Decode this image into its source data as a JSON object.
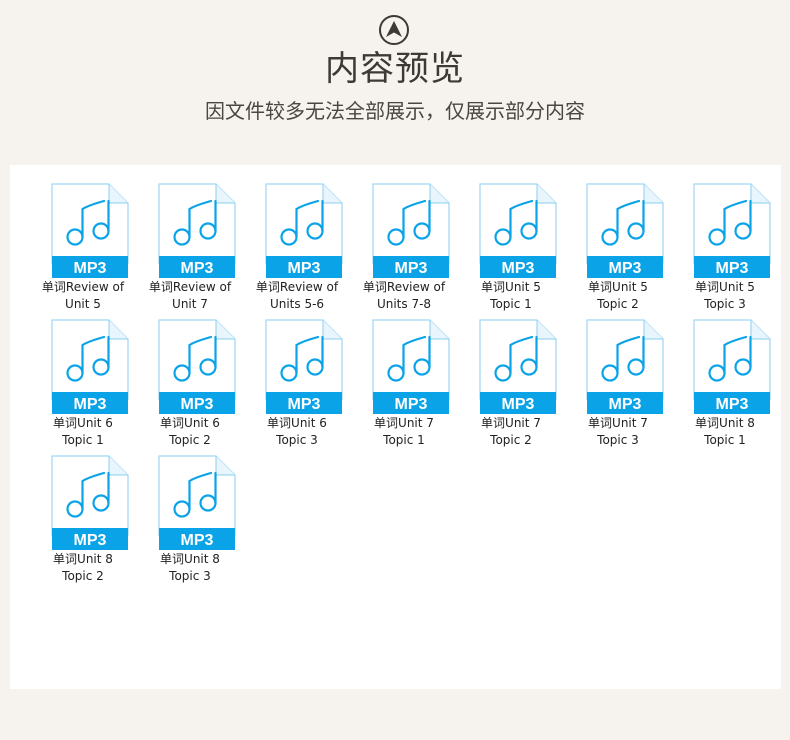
{
  "header": {
    "title": "内容预览",
    "subtitle": "因文件较多无法全部展示，仅展示部分内容",
    "logo_icon": "circle-up-arrow-icon"
  },
  "files": {
    "badge": "MP3",
    "icon": "music-note-file-icon",
    "accent_color": "#0aa3e8",
    "items": [
      {
        "line1": "单词Review of",
        "line2": "Unit 5"
      },
      {
        "line1": "单词Review of",
        "line2": "Unit 7"
      },
      {
        "line1": "单词Review of",
        "line2": "Units 5-6"
      },
      {
        "line1": "单词Review of",
        "line2": "Units 7-8"
      },
      {
        "line1": "单词Unit 5",
        "line2": "Topic 1"
      },
      {
        "line1": "单词Unit 5",
        "line2": "Topic 2"
      },
      {
        "line1": "单词Unit 5",
        "line2": "Topic 3"
      },
      {
        "line1": "单词Unit 6",
        "line2": "Topic 1"
      },
      {
        "line1": "单词Unit 6",
        "line2": "Topic 2"
      },
      {
        "line1": "单词Unit 6",
        "line2": "Topic 3"
      },
      {
        "line1": "单词Unit 7",
        "line2": "Topic 1"
      },
      {
        "line1": "单词Unit 7",
        "line2": "Topic 2"
      },
      {
        "line1": "单词Unit 7",
        "line2": "Topic 3"
      },
      {
        "line1": "单词Unit 8",
        "line2": "Topic 1"
      },
      {
        "line1": "单词Unit 8",
        "line2": "Topic 2"
      },
      {
        "line1": "单词Unit 8",
        "line2": "Topic 3"
      }
    ]
  }
}
